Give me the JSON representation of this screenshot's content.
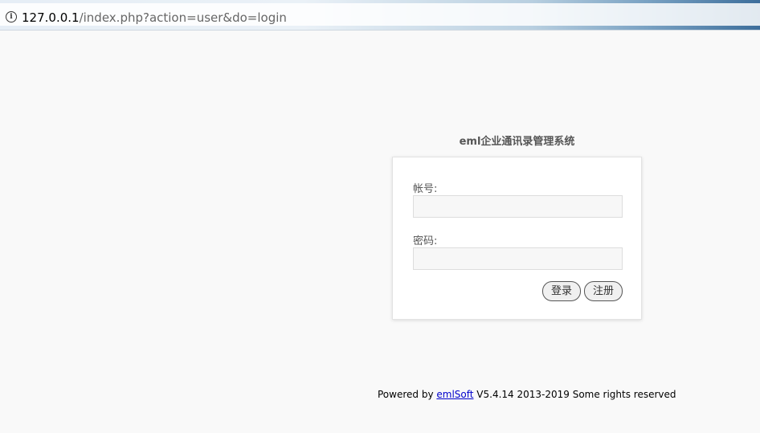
{
  "browser": {
    "url_host": "127.0.0.1",
    "url_path": "/index.php?action=user&do=login"
  },
  "login": {
    "title": "eml企业通讯录管理系统",
    "account_label": "帐号:",
    "account_value": "",
    "password_label": "密码:",
    "password_value": "",
    "login_button": "登录",
    "register_button": "注册"
  },
  "footer": {
    "prefix": "Powered by ",
    "link_text": "emlSoft",
    "suffix": " V5.4.14 2013-2019 Some rights reserved"
  }
}
